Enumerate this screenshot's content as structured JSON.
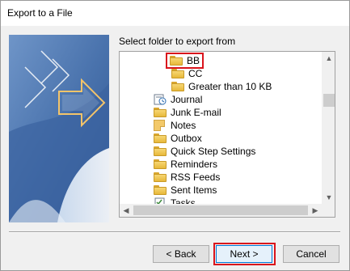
{
  "window": {
    "title": "Export to a File"
  },
  "prompt": "Select folder to export from",
  "tree": {
    "items": [
      {
        "label": "BB",
        "icon": "folder-icon",
        "selected": true
      },
      {
        "label": "CC",
        "icon": "folder-icon"
      },
      {
        "label": "Greater than 10 KB",
        "icon": "folder-icon"
      },
      {
        "label": "Journal",
        "icon": "journal-icon"
      },
      {
        "label": "Junk E-mail",
        "icon": "folder-icon"
      },
      {
        "label": "Notes",
        "icon": "notes-icon"
      },
      {
        "label": "Outbox",
        "icon": "folder-icon"
      },
      {
        "label": "Quick Step Settings",
        "icon": "folder-icon"
      },
      {
        "label": "Reminders",
        "icon": "folder-icon"
      },
      {
        "label": "RSS Feeds",
        "icon": "folder-icon"
      },
      {
        "label": "Sent Items",
        "icon": "folder-icon"
      },
      {
        "label": "Tasks",
        "icon": "tasks-icon"
      }
    ]
  },
  "buttons": {
    "back": "< Back",
    "next": "Next >",
    "cancel": "Cancel"
  },
  "colors": {
    "highlight": "#d9141c",
    "folder": "#f7d774",
    "accent": "#0078d7"
  }
}
